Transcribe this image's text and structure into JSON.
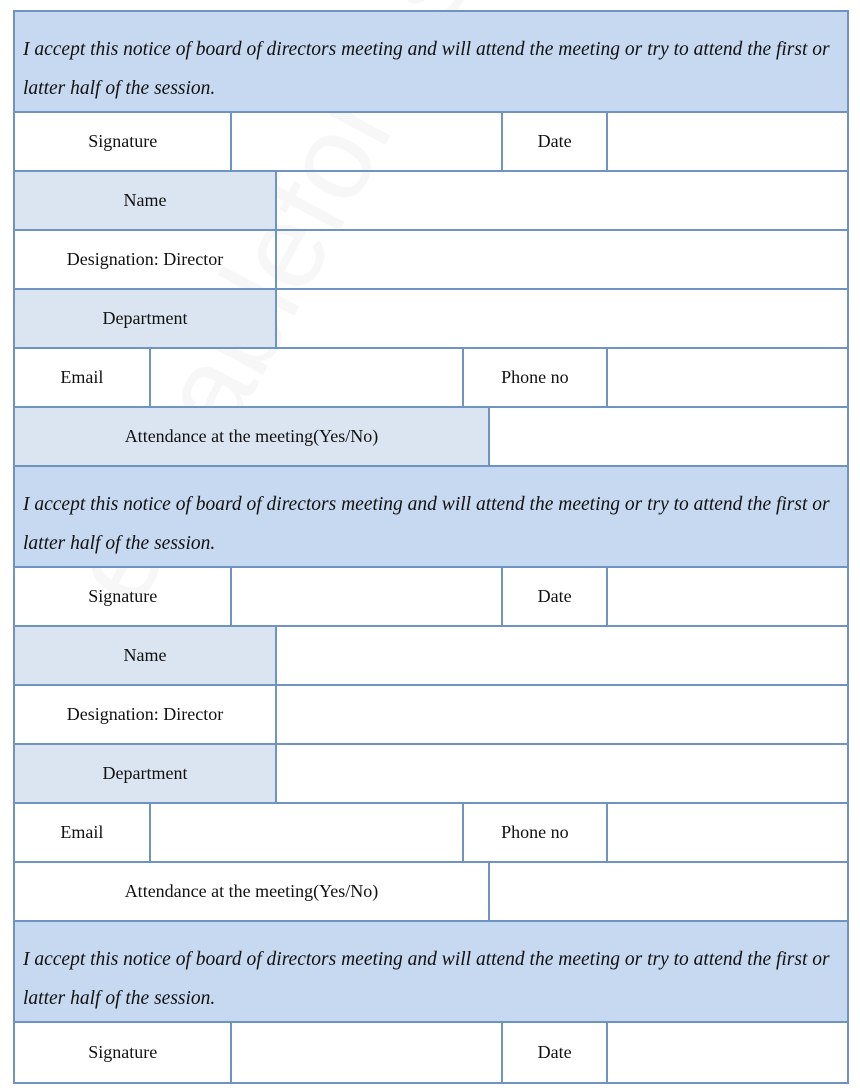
{
  "watermark": "editableforms.com",
  "colors": {
    "border": "#6f94c2",
    "header_bg": "#c6d9f0",
    "label_bg": "#dbe5f1"
  },
  "blocks": [
    {
      "statement": "I accept this notice of board of directors meeting and will attend the meeting or try to attend the first or latter half of the session.",
      "signature": "Signature",
      "date": "Date",
      "name": "Name",
      "designation": "Designation: Director",
      "department": "Department",
      "email": "Email",
      "phone": "Phone no",
      "attendance": "Attendance at the meeting(Yes/No)",
      "attendance_shaded": true
    },
    {
      "statement": "I accept this notice of board of directors meeting and will attend the meeting or try to attend the first or latter half of the session.",
      "signature": "Signature",
      "date": "Date",
      "name": "Name",
      "designation": "Designation: Director",
      "department": "Department",
      "email": "Email",
      "phone": "Phone no",
      "attendance": "Attendance at the meeting(Yes/No)",
      "attendance_shaded": false
    },
    {
      "statement": "I accept this notice of board of directors meeting and will attend the meeting or try to attend the first or latter half of the session.",
      "signature": "Signature",
      "date": "Date"
    }
  ]
}
